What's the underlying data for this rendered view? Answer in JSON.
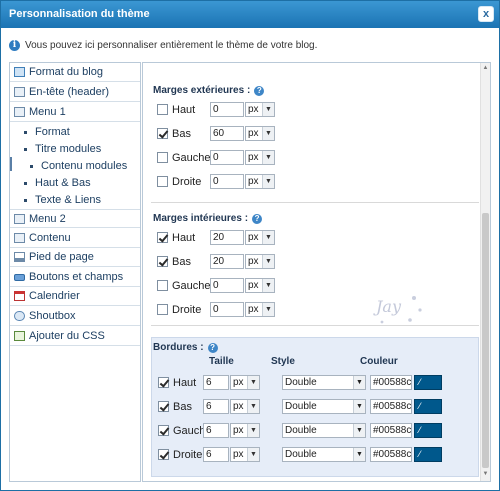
{
  "dialog": {
    "title": "Personnalisation du thème",
    "close_label": "x"
  },
  "info": {
    "icon": "info-icon",
    "text": "Vous pouvez ici personnaliser entièrement le thème de votre blog."
  },
  "sidebar": {
    "items": [
      {
        "label": "Format du blog",
        "icon": "folder-icon"
      },
      {
        "label": "En-tête (header)",
        "icon": "header-icon"
      },
      {
        "label": "Menu 1",
        "icon": "menu-icon"
      },
      {
        "label": "Menu 2",
        "icon": "menu-icon"
      },
      {
        "label": "Contenu",
        "icon": "content-icon"
      },
      {
        "label": "Pied de page",
        "icon": "footer-icon"
      },
      {
        "label": "Boutons et champs",
        "icon": "button-icon"
      },
      {
        "label": "Calendrier",
        "icon": "calendar-icon"
      },
      {
        "label": "Shoutbox",
        "icon": "chat-icon"
      },
      {
        "label": "Ajouter du CSS",
        "icon": "css-icon"
      }
    ],
    "menu1_subitems": [
      {
        "label": "Format"
      },
      {
        "label": "Titre modules"
      },
      {
        "label": "Contenu modules"
      },
      {
        "label": "Haut & Bas"
      },
      {
        "label": "Texte & Liens"
      }
    ]
  },
  "margins_ext": {
    "title": "Marges extérieures :",
    "rows": [
      {
        "label": "Haut",
        "checked": false,
        "value": "0",
        "unit": "px"
      },
      {
        "label": "Bas",
        "checked": true,
        "value": "60",
        "unit": "px"
      },
      {
        "label": "Gauche",
        "checked": false,
        "value": "0",
        "unit": "px"
      },
      {
        "label": "Droite",
        "checked": false,
        "value": "0",
        "unit": "px"
      }
    ]
  },
  "margins_int": {
    "title": "Marges intérieures :",
    "rows": [
      {
        "label": "Haut",
        "checked": true,
        "value": "20",
        "unit": "px"
      },
      {
        "label": "Bas",
        "checked": true,
        "value": "20",
        "unit": "px"
      },
      {
        "label": "Gauche",
        "checked": false,
        "value": "0",
        "unit": "px"
      },
      {
        "label": "Droite",
        "checked": false,
        "value": "0",
        "unit": "px"
      }
    ]
  },
  "borders": {
    "title": "Bordures :",
    "col_size": "Taille",
    "col_style": "Style",
    "col_color": "Couleur",
    "rows": [
      {
        "label": "Haut",
        "checked": true,
        "size": "6",
        "unit": "px",
        "style": "Double",
        "color": "#00588c"
      },
      {
        "label": "Bas",
        "checked": true,
        "size": "6",
        "unit": "px",
        "style": "Double",
        "color": "#00588c"
      },
      {
        "label": "Gauche",
        "checked": true,
        "size": "6",
        "unit": "px",
        "style": "Double",
        "color": "#00588c"
      },
      {
        "label": "Droite",
        "checked": true,
        "size": "6",
        "unit": "px",
        "style": "Double",
        "color": "#00588c"
      }
    ]
  },
  "colors": {
    "titlebar": "#1b73b3",
    "border_swatch": "#00588c",
    "panel_bg": "#e6edf8"
  }
}
